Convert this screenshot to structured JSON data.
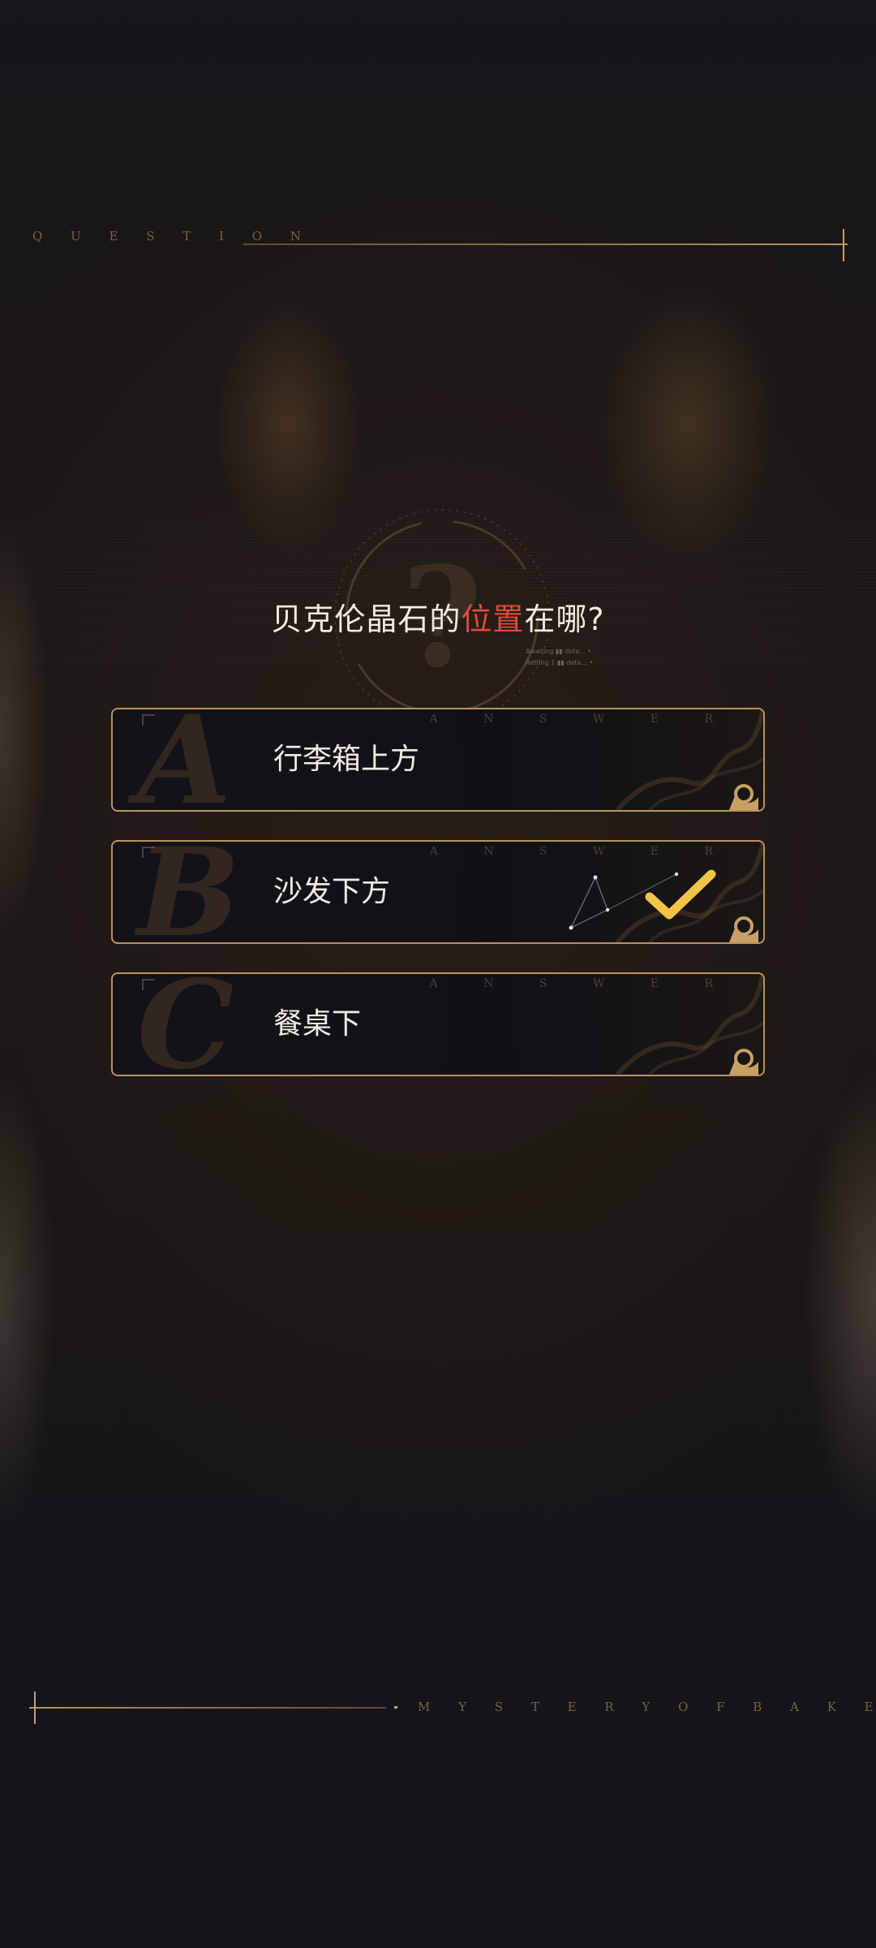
{
  "header": {
    "label": "Q U E S T I O N"
  },
  "question": {
    "text_before": "贝克伦晶石的",
    "text_highlight": "位置",
    "text_after": "在哪?",
    "note_line1": "Awaiting ▮▮ deta... •",
    "note_line2": "Retting 1 ▮▮ deta... •",
    "highlight_color": "#e24a3a"
  },
  "options": [
    {
      "letter": "A",
      "text": "行李箱上方",
      "deco": "A N S W E R",
      "selected": false
    },
    {
      "letter": "B",
      "text": "沙发下方",
      "deco": "A N S W E R",
      "selected": true
    },
    {
      "letter": "C",
      "text": "餐桌下",
      "deco": "A N S W E R",
      "selected": false
    }
  ],
  "footer": {
    "label": "M Y S T E R Y   O F   B A K E R L O N"
  },
  "colors": {
    "accent_gold": "#c9a064",
    "check_yellow": "#f2c445",
    "background": "#141419"
  },
  "icons": {
    "check": "checkmark-icon",
    "ornament": "filigree-ornament-icon",
    "emblem": "question-mark-emblem-icon"
  }
}
